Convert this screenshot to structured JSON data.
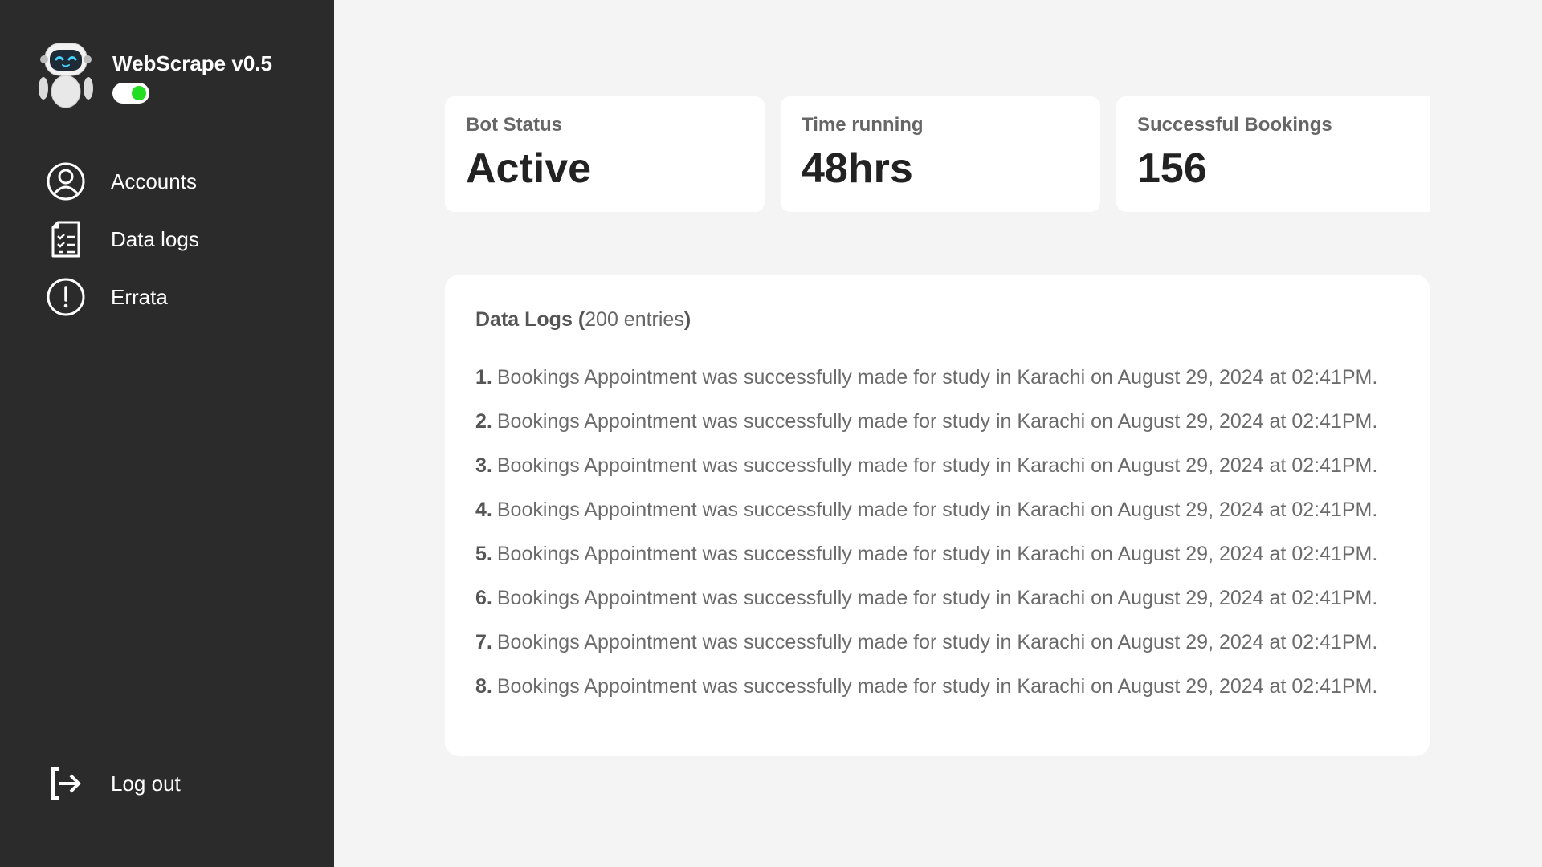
{
  "app": {
    "title": "WebScrape v0.5",
    "bot_enabled": true,
    "toggle_color": "#22dd22"
  },
  "sidebar": {
    "items": [
      {
        "label": "Accounts",
        "icon": "user-circle-icon"
      },
      {
        "label": "Data logs",
        "icon": "clipboard-list-icon"
      },
      {
        "label": "Errata",
        "icon": "alert-circle-icon"
      }
    ],
    "logout_label": "Log out",
    "logout_icon": "logout-icon"
  },
  "stats": [
    {
      "label": "Bot Status",
      "value": "Active"
    },
    {
      "label": "Time running",
      "value": "48hrs"
    },
    {
      "label": "Successful Bookings",
      "value": "156"
    }
  ],
  "logs": {
    "title": "Data Logs",
    "open_paren": "(",
    "count_text": "200 entries",
    "close_paren": ")",
    "entries": [
      {
        "num": "1.",
        "text": "Bookings Appointment was successfully made for study in Karachi on August 29, 2024 at 02:41PM."
      },
      {
        "num": "2.",
        "text": "Bookings Appointment was successfully made for study in Karachi on August 29, 2024 at 02:41PM."
      },
      {
        "num": "3.",
        "text": "Bookings Appointment was successfully made for study in Karachi on August 29, 2024 at 02:41PM."
      },
      {
        "num": "4.",
        "text": "Bookings Appointment was successfully made for study in Karachi on August 29, 2024 at 02:41PM."
      },
      {
        "num": "5.",
        "text": "Bookings Appointment was successfully made for study in Karachi on August 29, 2024 at 02:41PM."
      },
      {
        "num": "6.",
        "text": "Bookings Appointment was successfully made for study in Karachi on August 29, 2024 at 02:41PM."
      },
      {
        "num": "7.",
        "text": "Bookings Appointment was successfully made for study in Karachi on August 29, 2024 at 02:41PM."
      },
      {
        "num": "8.",
        "text": "Bookings Appointment was successfully made for study in Karachi on August 29, 2024 at 02:41PM."
      }
    ]
  }
}
